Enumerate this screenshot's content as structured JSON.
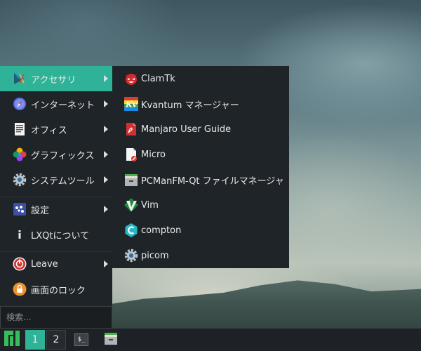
{
  "main_menu": {
    "items": [
      {
        "label": "アクセサリ",
        "icon": "accessories-icon",
        "submenu": true,
        "active": true
      },
      {
        "label": "インターネット",
        "icon": "internet-compass-icon",
        "submenu": true
      },
      {
        "label": "オフィス",
        "icon": "office-document-icon",
        "submenu": true
      },
      {
        "label": "グラフィックス",
        "icon": "graphics-palette-icon",
        "submenu": true
      },
      {
        "label": "システムツール",
        "icon": "system-tools-gear-icon",
        "submenu": true
      },
      {
        "label": "設定",
        "icon": "settings-panel-icon",
        "submenu": true
      },
      {
        "label": "LXQtについて",
        "icon": "info-icon",
        "submenu": false
      },
      {
        "label": "Leave",
        "icon": "power-icon",
        "submenu": true
      },
      {
        "label": "画面のロック",
        "icon": "lock-icon",
        "submenu": false
      }
    ],
    "search_placeholder": "検索..."
  },
  "accessories_submenu": {
    "items": [
      {
        "label": "ClamTk",
        "icon": "clamtk-devil-icon"
      },
      {
        "label": "Kvantum マネージャー",
        "icon": "kvantum-icon"
      },
      {
        "label": "Manjaro User Guide",
        "icon": "pdf-document-icon"
      },
      {
        "label": "Micro",
        "icon": "micro-editor-icon"
      },
      {
        "label": "PCManFM-Qt ファイルマネージャ",
        "icon": "file-manager-cabinet-icon"
      },
      {
        "label": "Vim",
        "icon": "vim-icon"
      },
      {
        "label": "compton",
        "icon": "compton-icon"
      },
      {
        "label": "picom",
        "icon": "picom-gear-icon"
      }
    ]
  },
  "taskbar": {
    "start_icon": "manjaro-logo-icon",
    "desktops": [
      "1",
      "2"
    ],
    "active_desktop": "1",
    "launchers": [
      "terminal-icon",
      "file-manager-cabinet-icon"
    ],
    "terminal_glyph": "$_"
  },
  "colors": {
    "accent": "#2eb398",
    "menu_bg": "#1f2428",
    "taskbar_bg": "#1e2226"
  }
}
